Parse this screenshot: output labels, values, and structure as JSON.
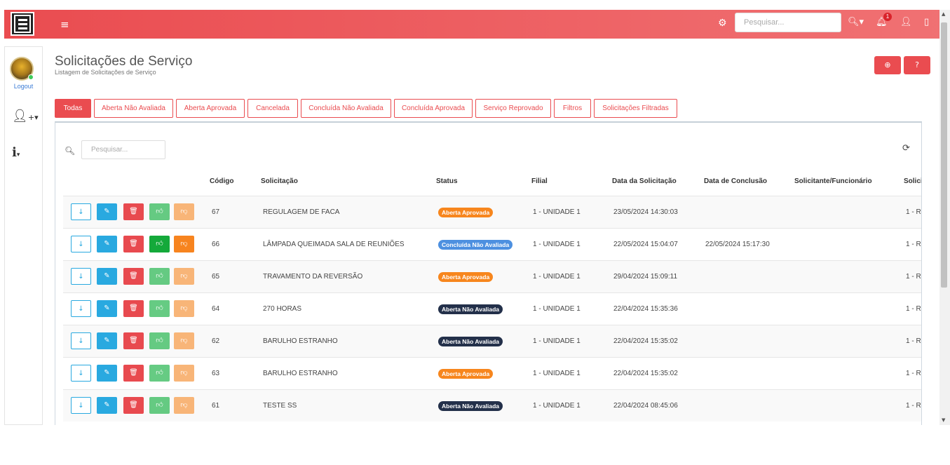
{
  "topbar": {
    "menu_icon": "hamburger-icon",
    "search_placeholder": "Pesquisar...",
    "notification_count": "1",
    "accent": "#ea4c50"
  },
  "sidebar": {
    "logout_label": "Logout"
  },
  "header": {
    "title": "Solicitações de Serviço",
    "subtitle": "Listagem de Solicitações de Serviço"
  },
  "tabs": [
    {
      "label": "Todas"
    },
    {
      "label": "Aberta Não Avaliada"
    },
    {
      "label": "Aberta Aprovada"
    },
    {
      "label": "Cancelada"
    },
    {
      "label": "Concluída Não Avaliada"
    },
    {
      "label": "Concluída Aprovada"
    },
    {
      "label": "Serviço Reprovado"
    },
    {
      "label": "Filtros"
    },
    {
      "label": "Solicitações Filtradas"
    }
  ],
  "table": {
    "search_placeholder": "Pesquisar...",
    "columns": [
      "Código",
      "Solicitação",
      "Status",
      "Filial",
      "Data da Solicitação",
      "Data de Conclusão",
      "Solicitante/Funcionário",
      "Solici"
    ],
    "rows": [
      {
        "codigo": "67",
        "solicitacao": "REGULAGEM DE FACA",
        "status": "Aberta Aprovada",
        "filial": "1 - UNIDADE 1",
        "data_solicitacao": "23/05/2024 14:30:03",
        "data_conclusao": "",
        "solicitante": "",
        "extra": "1 - R"
      },
      {
        "codigo": "66",
        "solicitacao": "LÂMPADA QUEIMADA SALA DE REUNIÕES",
        "status": "Concluída Não Avaliada",
        "filial": "1 - UNIDADE 1",
        "data_solicitacao": "22/05/2024 15:04:07",
        "data_conclusao": "22/05/2024 15:17:30",
        "solicitante": "",
        "extra": "1 - R"
      },
      {
        "codigo": "65",
        "solicitacao": "TRAVAMENTO DA REVERSÃO",
        "status": "Aberta Aprovada",
        "filial": "1 - UNIDADE 1",
        "data_solicitacao": "29/04/2024 15:09:11",
        "data_conclusao": "",
        "solicitante": "",
        "extra": "1 - R"
      },
      {
        "codigo": "64",
        "solicitacao": "270 HORAS",
        "status": "Aberta Não Avaliada",
        "filial": "1 - UNIDADE 1",
        "data_solicitacao": "22/04/2024 15:35:36",
        "data_conclusao": "",
        "solicitante": "",
        "extra": "1 - R"
      },
      {
        "codigo": "62",
        "solicitacao": "BARULHO ESTRANHO",
        "status": "Aberta Não Avaliada",
        "filial": "1 - UNIDADE 1",
        "data_solicitacao": "22/04/2024 15:35:02",
        "data_conclusao": "",
        "solicitante": "",
        "extra": "1 - R"
      },
      {
        "codigo": "63",
        "solicitacao": "BARULHO ESTRANHO",
        "status": "Aberta Aprovada",
        "filial": "1 - UNIDADE 1",
        "data_solicitacao": "22/04/2024 15:35:02",
        "data_conclusao": "",
        "solicitante": "",
        "extra": "1 - R"
      },
      {
        "codigo": "61",
        "solicitacao": "TESTE SS",
        "status": "Aberta Não Avaliada",
        "filial": "1 - UNIDADE 1",
        "data_solicitacao": "22/04/2024 08:45:06",
        "data_conclusao": "",
        "solicitante": "",
        "extra": "1 - R"
      }
    ]
  },
  "status_colors": {
    "Aberta Aprovada": "#f7861d",
    "Aberta Não Avaliada": "#23304a",
    "Concluída Não Avaliada": "#4d90e0"
  }
}
